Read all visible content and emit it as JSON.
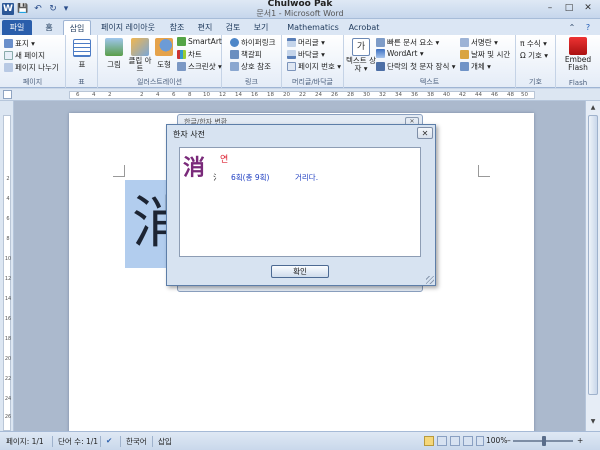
{
  "titlebar": {
    "user_name": "Chulwoo Pak",
    "doc_title": "문서1 - Microsoft Word",
    "word_icon": "W",
    "save_icon": "💾",
    "undo_icon": "↶",
    "redo_icon": "↻",
    "customize_icon": "▾"
  },
  "window": {
    "minimize": "–",
    "maximize": "□",
    "close": "✕"
  },
  "tabs": [
    "파일",
    "홈",
    "삽입",
    "페이지 레이아웃",
    "참조",
    "편지",
    "검토",
    "보기",
    "Mathematics",
    "Acrobat"
  ],
  "help_icons": {
    "collapse": "⌃",
    "help": "?"
  },
  "ribbon": {
    "pages": {
      "label": "페이지",
      "items": [
        "표지 ▾",
        "새 페이지",
        "페이지 나누기"
      ]
    },
    "table": {
      "label": "표",
      "items": [
        "표"
      ]
    },
    "illust": {
      "label": "일러스트레이션",
      "items": [
        "그림",
        "클립 아트",
        "도형",
        "SmartArt",
        "차트",
        "스크린샷 ▾"
      ]
    },
    "links": {
      "label": "링크",
      "items": [
        "하이퍼링크",
        "책갈피",
        "상호 참조"
      ]
    },
    "headfoot": {
      "label": "머리글/바닥글",
      "items": [
        "머리글 ▾",
        "바닥글 ▾",
        "페이지 번호 ▾"
      ]
    },
    "text": {
      "label": "텍스트",
      "items": [
        "텍스트 상자 ▾",
        "빠른 문서 요소 ▾",
        "WordArt ▾",
        "단락의 첫 문자 장식 ▾",
        "서명란 ▾",
        "날짜 및 시간",
        "개체 ▾"
      ]
    },
    "symbols": {
      "label": "기호",
      "items": [
        "π 수식 ▾",
        "Ω 기호 ▾"
      ]
    },
    "flash": {
      "label": "Flash",
      "items": [
        "Embed Flash"
      ]
    }
  },
  "ruler_ticks": [
    "6",
    "4",
    "2",
    "",
    "2",
    "4",
    "6",
    "8",
    "10",
    "12",
    "14",
    "16",
    "18",
    "20",
    "22",
    "24",
    "26",
    "28",
    "30",
    "32",
    "34",
    "36",
    "38",
    "40",
    "42",
    "44",
    "46",
    "48",
    "50",
    "52"
  ],
  "vruler_ticks": [
    "2",
    "4",
    "6",
    "8",
    "10",
    "12",
    "14",
    "16",
    "18",
    "20",
    "22",
    "24",
    "26",
    "28"
  ],
  "document": {
    "selected_char": "消"
  },
  "bg_dialog": {
    "title": "한글/한자 변환"
  },
  "dialog": {
    "title": "한자 사전",
    "close": "✕",
    "hanja": "消",
    "reading": "연",
    "radical": "氵",
    "strokes": "6획(총 9획)",
    "meaning": "거리다.",
    "ok_label": "확인"
  },
  "status": {
    "page": "페이지: 1/1",
    "words": "단어 수: 1/1",
    "language": "한국어",
    "mode": "삽입",
    "zoom": "100%",
    "zoom_minus": "–",
    "zoom_plus": "+"
  }
}
